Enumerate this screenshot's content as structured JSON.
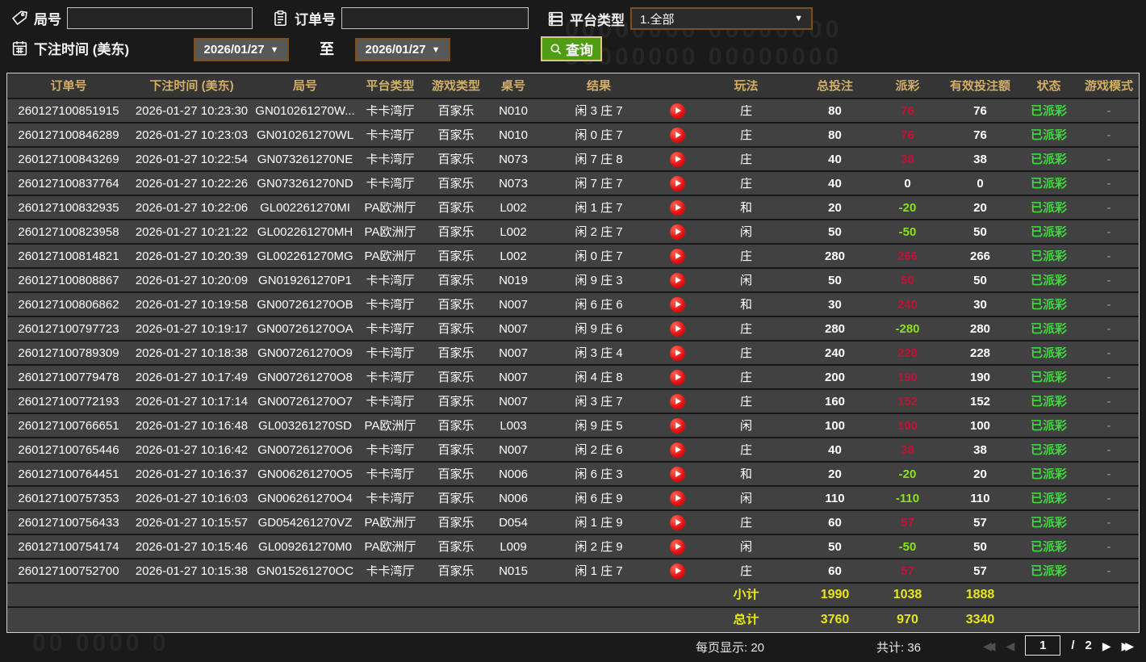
{
  "filters": {
    "game_no": {
      "label": "局号",
      "value": ""
    },
    "order_no": {
      "label": "订单号",
      "value": ""
    },
    "platform": {
      "label": "平台类型",
      "value": "1.全部"
    },
    "bet_time": {
      "label": "下注时间 (美东)",
      "from": "2026/01/27",
      "to": "2026/01/27",
      "to_word": "至"
    },
    "query_label": "查询"
  },
  "table": {
    "columns": [
      "订单号",
      "下注时间 (美东)",
      "局号",
      "平台类型",
      "游戏类型",
      "桌号",
      "结果",
      "玩法",
      "总投注",
      "派彩",
      "有效投注额",
      "状态",
      "游戏模式"
    ],
    "rows": [
      {
        "order_id": "260127100851915",
        "bet_time": "2026-01-27 10:23:30",
        "game_no": "GN010261270W...",
        "platform": "卡卡湾厅",
        "game_type": "百家乐",
        "table_no": "N010",
        "result": "闲 3 庄 7",
        "play": "庄",
        "total_bet": "80",
        "payout": "76",
        "valid_bet": "76",
        "status": "已派彩",
        "mode": "-"
      },
      {
        "order_id": "260127100846289",
        "bet_time": "2026-01-27 10:23:03",
        "game_no": "GN010261270WL",
        "platform": "卡卡湾厅",
        "game_type": "百家乐",
        "table_no": "N010",
        "result": "闲 0 庄 7",
        "play": "庄",
        "total_bet": "80",
        "payout": "76",
        "valid_bet": "76",
        "status": "已派彩",
        "mode": "-"
      },
      {
        "order_id": "260127100843269",
        "bet_time": "2026-01-27 10:22:54",
        "game_no": "GN073261270NE",
        "platform": "卡卡湾厅",
        "game_type": "百家乐",
        "table_no": "N073",
        "result": "闲 7 庄 8",
        "play": "庄",
        "total_bet": "40",
        "payout": "38",
        "valid_bet": "38",
        "status": "已派彩",
        "mode": "-"
      },
      {
        "order_id": "260127100837764",
        "bet_time": "2026-01-27 10:22:26",
        "game_no": "GN073261270ND",
        "platform": "卡卡湾厅",
        "game_type": "百家乐",
        "table_no": "N073",
        "result": "闲 7 庄 7",
        "play": "庄",
        "total_bet": "40",
        "payout": "0",
        "valid_bet": "0",
        "status": "已派彩",
        "mode": "-"
      },
      {
        "order_id": "260127100832935",
        "bet_time": "2026-01-27 10:22:06",
        "game_no": "GL002261270MI",
        "platform": "PA欧洲厅",
        "game_type": "百家乐",
        "table_no": "L002",
        "result": "闲 1 庄 7",
        "play": "和",
        "total_bet": "20",
        "payout": "-20",
        "valid_bet": "20",
        "status": "已派彩",
        "mode": "-"
      },
      {
        "order_id": "260127100823958",
        "bet_time": "2026-01-27 10:21:22",
        "game_no": "GL002261270MH",
        "platform": "PA欧洲厅",
        "game_type": "百家乐",
        "table_no": "L002",
        "result": "闲 2 庄 7",
        "play": "闲",
        "total_bet": "50",
        "payout": "-50",
        "valid_bet": "50",
        "status": "已派彩",
        "mode": "-"
      },
      {
        "order_id": "260127100814821",
        "bet_time": "2026-01-27 10:20:39",
        "game_no": "GL002261270MG",
        "platform": "PA欧洲厅",
        "game_type": "百家乐",
        "table_no": "L002",
        "result": "闲 0 庄 7",
        "play": "庄",
        "total_bet": "280",
        "payout": "266",
        "valid_bet": "266",
        "status": "已派彩",
        "mode": "-"
      },
      {
        "order_id": "260127100808867",
        "bet_time": "2026-01-27 10:20:09",
        "game_no": "GN019261270P1",
        "platform": "卡卡湾厅",
        "game_type": "百家乐",
        "table_no": "N019",
        "result": "闲 9 庄 3",
        "play": "闲",
        "total_bet": "50",
        "payout": "50",
        "valid_bet": "50",
        "status": "已派彩",
        "mode": "-"
      },
      {
        "order_id": "260127100806862",
        "bet_time": "2026-01-27 10:19:58",
        "game_no": "GN007261270OB",
        "platform": "卡卡湾厅",
        "game_type": "百家乐",
        "table_no": "N007",
        "result": "闲 6 庄 6",
        "play": "和",
        "total_bet": "30",
        "payout": "240",
        "valid_bet": "30",
        "status": "已派彩",
        "mode": "-"
      },
      {
        "order_id": "260127100797723",
        "bet_time": "2026-01-27 10:19:17",
        "game_no": "GN007261270OA",
        "platform": "卡卡湾厅",
        "game_type": "百家乐",
        "table_no": "N007",
        "result": "闲 9 庄 6",
        "play": "庄",
        "total_bet": "280",
        "payout": "-280",
        "valid_bet": "280",
        "status": "已派彩",
        "mode": "-"
      },
      {
        "order_id": "260127100789309",
        "bet_time": "2026-01-27 10:18:38",
        "game_no": "GN007261270O9",
        "platform": "卡卡湾厅",
        "game_type": "百家乐",
        "table_no": "N007",
        "result": "闲 3 庄 4",
        "play": "庄",
        "total_bet": "240",
        "payout": "228",
        "valid_bet": "228",
        "status": "已派彩",
        "mode": "-"
      },
      {
        "order_id": "260127100779478",
        "bet_time": "2026-01-27 10:17:49",
        "game_no": "GN007261270O8",
        "platform": "卡卡湾厅",
        "game_type": "百家乐",
        "table_no": "N007",
        "result": "闲 4 庄 8",
        "play": "庄",
        "total_bet": "200",
        "payout": "190",
        "valid_bet": "190",
        "status": "已派彩",
        "mode": "-"
      },
      {
        "order_id": "260127100772193",
        "bet_time": "2026-01-27 10:17:14",
        "game_no": "GN007261270O7",
        "platform": "卡卡湾厅",
        "game_type": "百家乐",
        "table_no": "N007",
        "result": "闲 3 庄 7",
        "play": "庄",
        "total_bet": "160",
        "payout": "152",
        "valid_bet": "152",
        "status": "已派彩",
        "mode": "-"
      },
      {
        "order_id": "260127100766651",
        "bet_time": "2026-01-27 10:16:48",
        "game_no": "GL003261270SD",
        "platform": "PA欧洲厅",
        "game_type": "百家乐",
        "table_no": "L003",
        "result": "闲 9 庄 5",
        "play": "闲",
        "total_bet": "100",
        "payout": "100",
        "valid_bet": "100",
        "status": "已派彩",
        "mode": "-"
      },
      {
        "order_id": "260127100765446",
        "bet_time": "2026-01-27 10:16:42",
        "game_no": "GN007261270O6",
        "platform": "卡卡湾厅",
        "game_type": "百家乐",
        "table_no": "N007",
        "result": "闲 2 庄 6",
        "play": "庄",
        "total_bet": "40",
        "payout": "38",
        "valid_bet": "38",
        "status": "已派彩",
        "mode": "-"
      },
      {
        "order_id": "260127100764451",
        "bet_time": "2026-01-27 10:16:37",
        "game_no": "GN006261270O5",
        "platform": "卡卡湾厅",
        "game_type": "百家乐",
        "table_no": "N006",
        "result": "闲 6 庄 3",
        "play": "和",
        "total_bet": "20",
        "payout": "-20",
        "valid_bet": "20",
        "status": "已派彩",
        "mode": "-"
      },
      {
        "order_id": "260127100757353",
        "bet_time": "2026-01-27 10:16:03",
        "game_no": "GN006261270O4",
        "platform": "卡卡湾厅",
        "game_type": "百家乐",
        "table_no": "N006",
        "result": "闲 6 庄 9",
        "play": "闲",
        "total_bet": "110",
        "payout": "-110",
        "valid_bet": "110",
        "status": "已派彩",
        "mode": "-"
      },
      {
        "order_id": "260127100756433",
        "bet_time": "2026-01-27 10:15:57",
        "game_no": "GD054261270VZ",
        "platform": "PA欧洲厅",
        "game_type": "百家乐",
        "table_no": "D054",
        "result": "闲 1 庄 9",
        "play": "庄",
        "total_bet": "60",
        "payout": "57",
        "valid_bet": "57",
        "status": "已派彩",
        "mode": "-"
      },
      {
        "order_id": "260127100754174",
        "bet_time": "2026-01-27 10:15:46",
        "game_no": "GL009261270M0",
        "platform": "PA欧洲厅",
        "game_type": "百家乐",
        "table_no": "L009",
        "result": "闲 2 庄 9",
        "play": "闲",
        "total_bet": "50",
        "payout": "-50",
        "valid_bet": "50",
        "status": "已派彩",
        "mode": "-"
      },
      {
        "order_id": "260127100752700",
        "bet_time": "2026-01-27 10:15:38",
        "game_no": "GN015261270OC",
        "platform": "卡卡湾厅",
        "game_type": "百家乐",
        "table_no": "N015",
        "result": "闲 1 庄 7",
        "play": "庄",
        "total_bet": "60",
        "payout": "57",
        "valid_bet": "57",
        "status": "已派彩",
        "mode": "-"
      }
    ],
    "subtotal": {
      "label": "小计",
      "total_bet": "1990",
      "payout": "1038",
      "valid_bet": "1888"
    },
    "total": {
      "label": "总计",
      "total_bet": "3760",
      "payout": "970",
      "valid_bet": "3340"
    }
  },
  "pagination": {
    "per_page": "每页显示: 20",
    "total_count": "共计: 36",
    "page": "1",
    "sep": "/",
    "pages": "2"
  },
  "colors": {
    "header_text": "#d2ae66",
    "payout_positive": "#c01236",
    "payout_negative": "#8ce01e",
    "status_green": "#3fd83f",
    "sum_yellow": "#e7e71b"
  },
  "decor": {
    "watermark_row": "00000000 00000000",
    "watermark_small": "00 0000 0"
  }
}
